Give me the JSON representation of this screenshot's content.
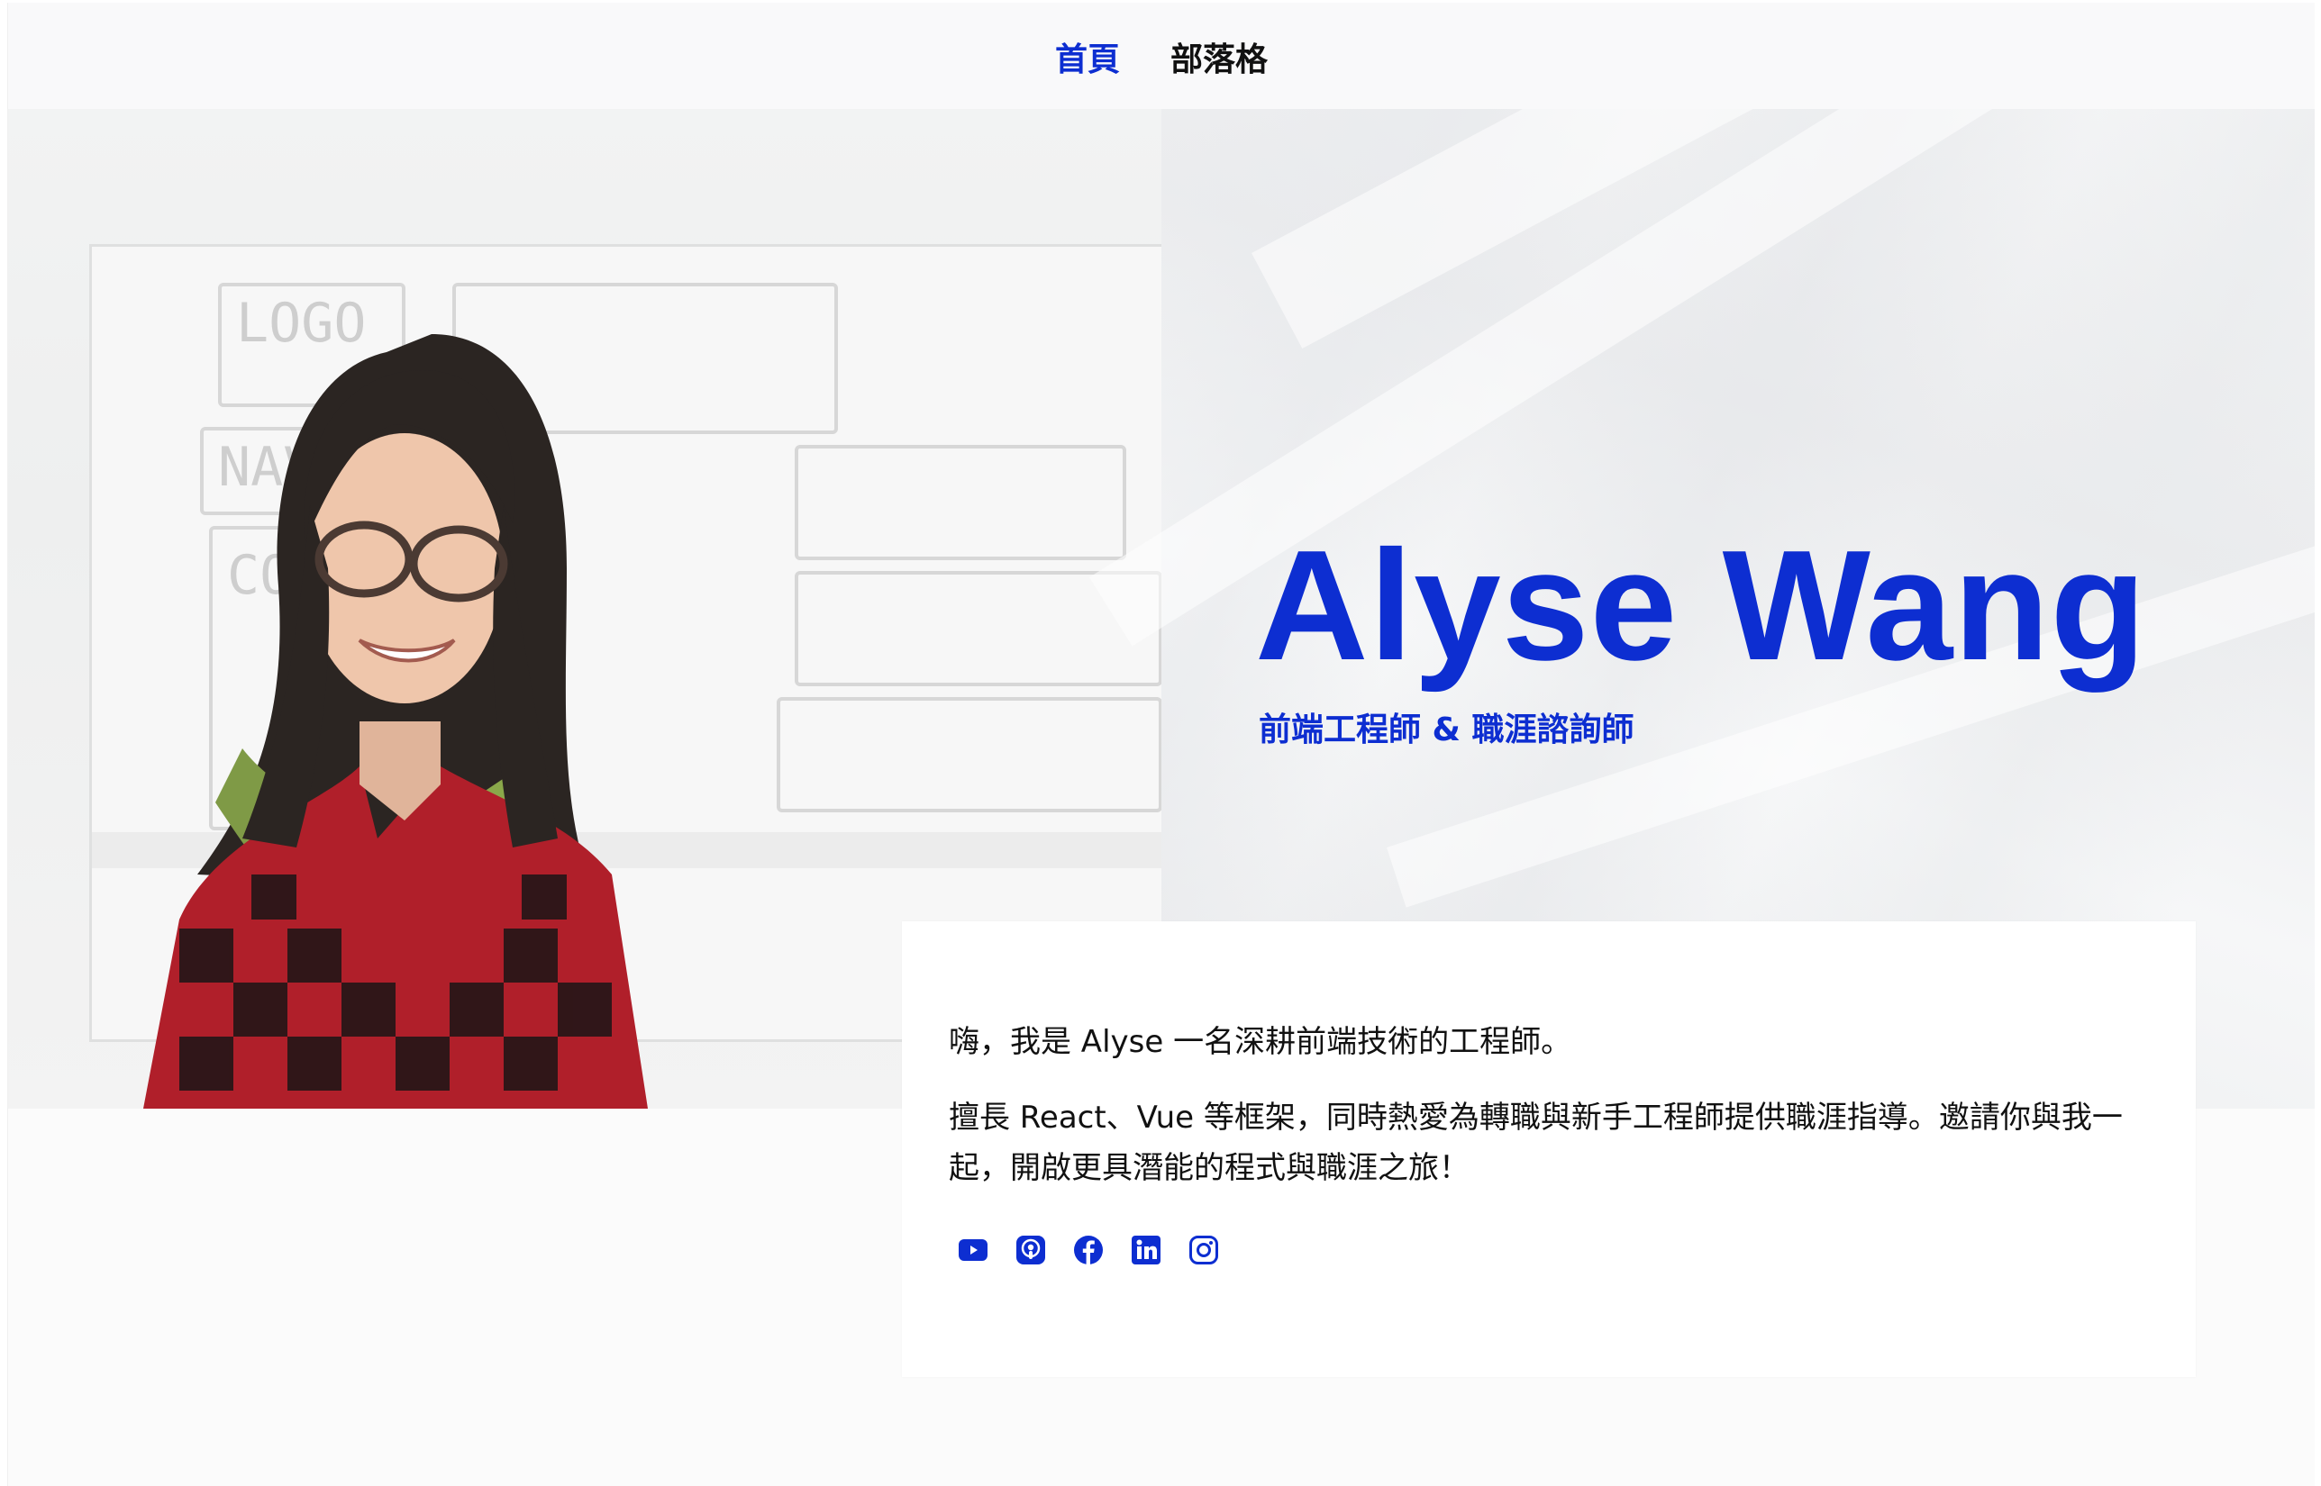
{
  "nav": {
    "items": [
      {
        "label": "首頁",
        "active": true
      },
      {
        "label": "部落格",
        "active": false
      }
    ]
  },
  "hero": {
    "name": "Alyse Wang",
    "subtitle": "前端工程師 & 職涯諮詢師"
  },
  "intro": {
    "line1": "嗨，我是 Alyse 一名深耕前端技術的工程師。",
    "line2": "擅長 React、Vue 等框架，同時熱愛為轉職與新手工程師提供職涯指導。邀請你與我一起，開啟更具潛能的程式與職涯之旅！"
  },
  "socials": [
    {
      "icon": "youtube-icon"
    },
    {
      "icon": "podcast-icon"
    },
    {
      "icon": "facebook-icon"
    },
    {
      "icon": "linkedin-icon"
    },
    {
      "icon": "instagram-icon"
    }
  ],
  "colors": {
    "accent": "#0d2ed1",
    "text": "#111111",
    "background": "#fbfbfb"
  }
}
